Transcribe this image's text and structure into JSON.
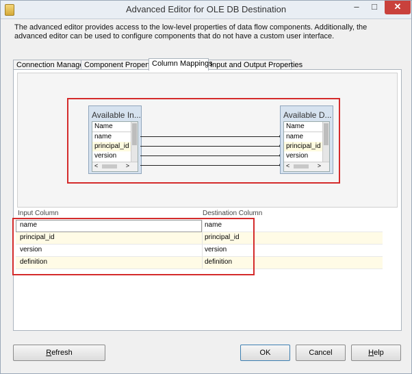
{
  "window": {
    "title": "Advanced Editor for OLE DB Destination",
    "minimize_glyph": "–",
    "maximize_glyph": "□",
    "close_glyph": "✕"
  },
  "description": "The advanced editor provides access to the low-level properties of data flow components. Additionally, the advanced editor can be used to configure components that do not have a custom user interface.",
  "tabs": [
    {
      "label": "Connection Managers"
    },
    {
      "label": "Component Properties"
    },
    {
      "label": "Column Mappings"
    },
    {
      "label": "Input and Output Properties"
    }
  ],
  "active_tab": "Column Mappings",
  "designer": {
    "input_table": {
      "title": "Available In...",
      "header": "Name",
      "columns": [
        "name",
        "principal_id",
        "version"
      ]
    },
    "destination_table": {
      "title": "Available D...",
      "header": "Name",
      "columns": [
        "name",
        "principal_id",
        "version"
      ]
    },
    "scroll_left": "<",
    "scroll_right": ">"
  },
  "grid": {
    "headers": {
      "input": "Input Column",
      "destination": "Destination Column"
    },
    "rows": [
      {
        "input": "name",
        "destination": "name"
      },
      {
        "input": "principal_id",
        "destination": "principal_id"
      },
      {
        "input": "version",
        "destination": "version"
      },
      {
        "input": "definition",
        "destination": "definition"
      }
    ]
  },
  "buttons": {
    "refresh_pre": "",
    "refresh_u": "R",
    "refresh_post": "efresh",
    "ok": "OK",
    "cancel": "Cancel",
    "help_pre": "",
    "help_u": "H",
    "help_post": "elp"
  },
  "colors": {
    "highlight_border": "#d42a2a",
    "table_header_bg": "#d6e2ef",
    "alt_row_bg": "#fffbe6"
  }
}
